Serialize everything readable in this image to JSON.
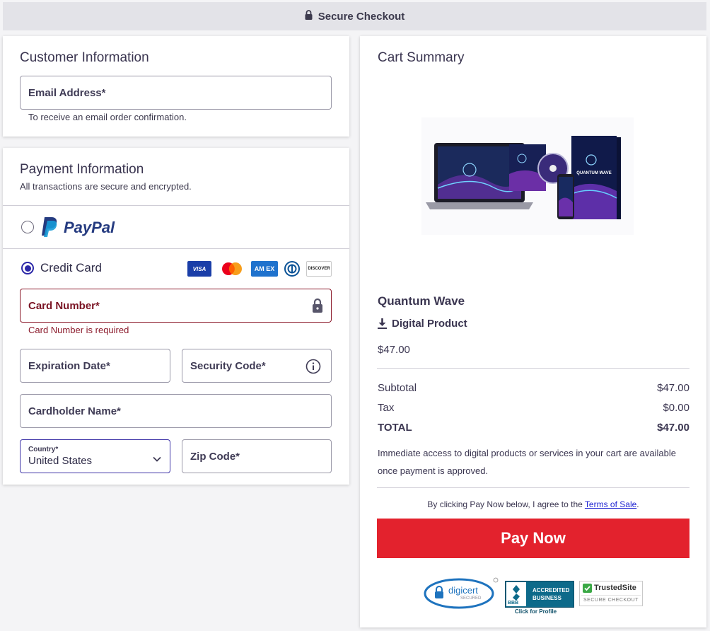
{
  "header": {
    "title": "Secure Checkout"
  },
  "customer": {
    "heading": "Customer Information",
    "email_label": "Email Address*",
    "email_hint": "To receive an email order confirmation."
  },
  "payment": {
    "heading": "Payment Information",
    "subheading": "All transactions are secure and encrypted.",
    "paypal_label": "PayPal",
    "paypal_selected": false,
    "credit_card_label": "Credit Card",
    "credit_card_selected": true,
    "card_brands": [
      "VISA",
      "MASTERCARD",
      "AMEX",
      "DINERS",
      "DISCOVER"
    ],
    "card_brand_text": {
      "visa": "VISA",
      "amex": "AM EX",
      "discover": "DISCOVER"
    },
    "card_number_label": "Card Number*",
    "card_number_error": "Card Number is required",
    "expiration_label": "Expiration Date*",
    "security_label": "Security Code*",
    "cardholder_label": "Cardholder Name*",
    "country_label": "Country*",
    "country_value": "United States",
    "zip_label": "Zip Code*"
  },
  "cart": {
    "heading": "Cart Summary",
    "product_name": "Quantum Wave",
    "product_type": "Digital Product",
    "product_price": "$47.00",
    "product_image_text": "QUANTUM WAVE",
    "subtotal_label": "Subtotal",
    "subtotal_value": "$47.00",
    "tax_label": "Tax",
    "tax_value": "$0.00",
    "total_label": "TOTAL",
    "total_value": "$47.00",
    "access_note": "Immediate access to digital products or services in your cart are available once payment is approved.",
    "terms_prefix": "By clicking Pay Now below, I agree to the ",
    "terms_link": "Terms of Sale",
    "terms_suffix": ".",
    "pay_button": "Pay Now"
  },
  "trust_badges": {
    "digicert": "digicert",
    "digicert_sub": "SECURED",
    "bbb_line1": "ACCREDITED",
    "bbb_line2": "BUSINESS",
    "bbb_logo": "BBB",
    "bbb_caption": "Click for Profile",
    "trusted_title": "TrustedSite",
    "trusted_sub": "SECURE CHECKOUT"
  },
  "colors": {
    "accent": "#2c28a8",
    "pay_button": "#e3222d",
    "error": "#8b1a2b",
    "paypal_dark": "#253b80",
    "paypal_light": "#179bd7"
  }
}
